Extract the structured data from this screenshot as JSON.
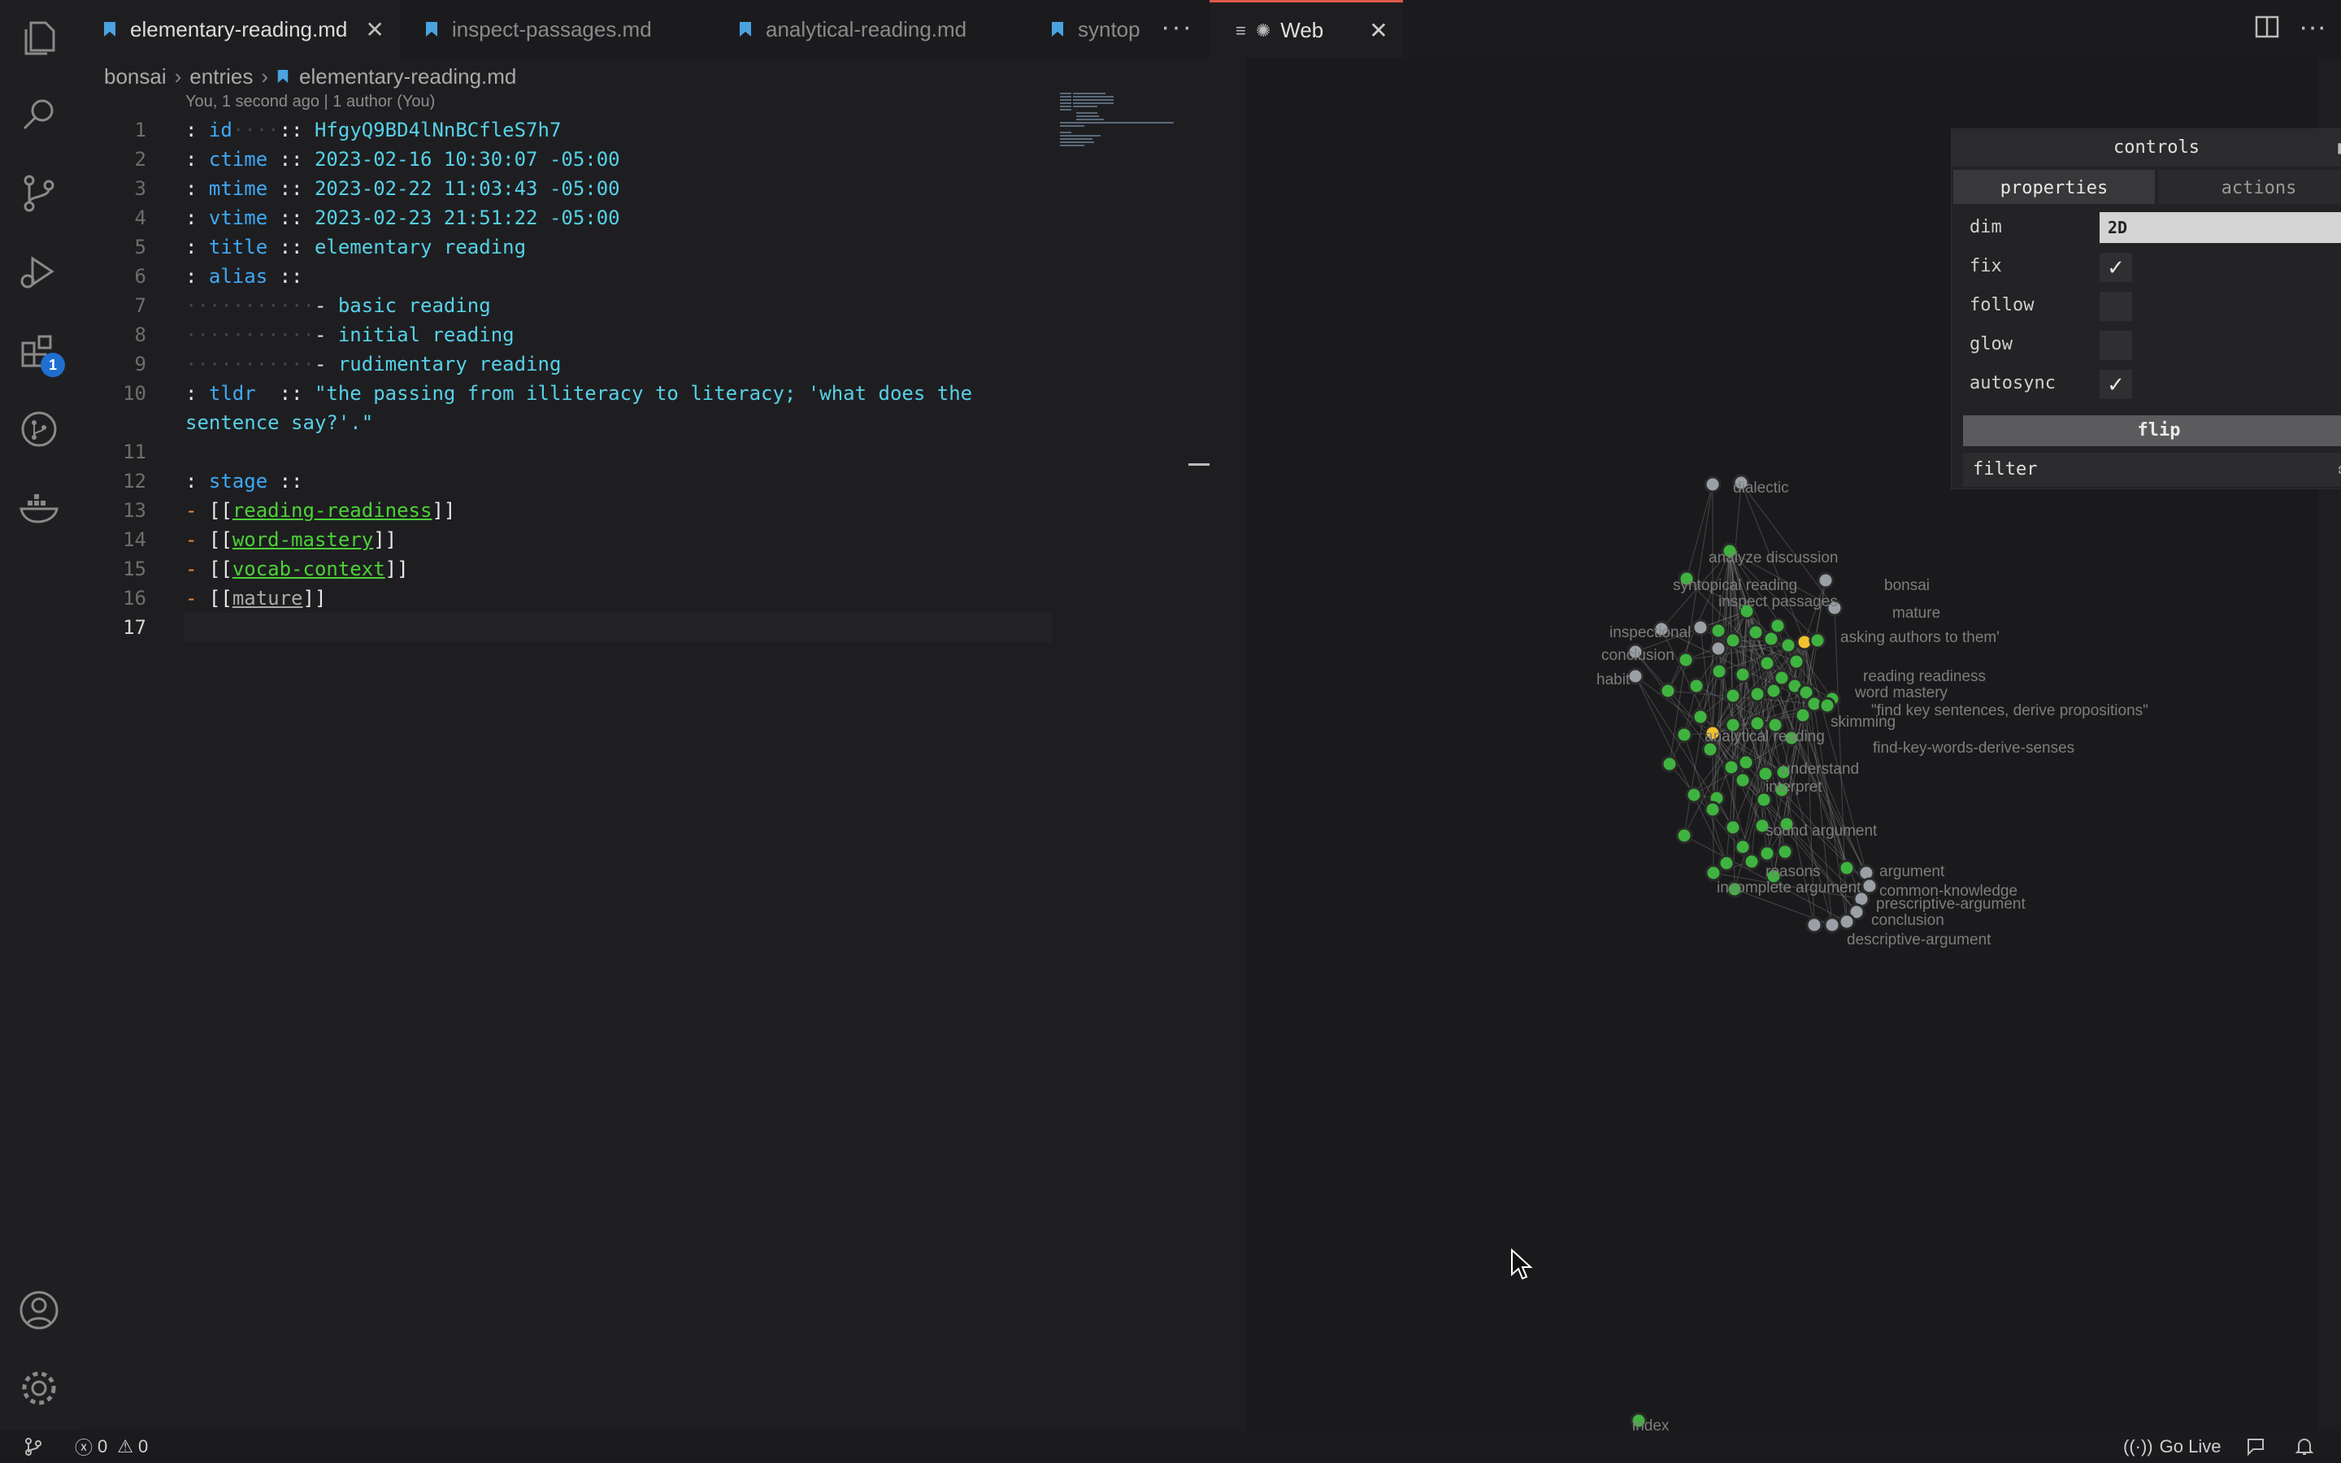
{
  "editor": {
    "tabs": [
      {
        "label": "elementary-reading.md",
        "active": true
      },
      {
        "label": "inspect-passages.md",
        "active": false
      },
      {
        "label": "analytical-reading.md",
        "active": false
      },
      {
        "label": "syntop",
        "active": false
      }
    ],
    "breadcrumb": [
      "bonsai",
      "entries",
      "elementary-reading.md"
    ],
    "blame": "You, 1 second ago | 1 author (You)",
    "line_numbers": [
      "1",
      "2",
      "3",
      "4",
      "5",
      "6",
      "7",
      "8",
      "9",
      "10",
      "",
      "11",
      "12",
      "13",
      "14",
      "15",
      "16",
      "17"
    ],
    "lines": {
      "l1": {
        "key": "id",
        "value": "HfgyQ9BD4lNnBCfleS7h7"
      },
      "l2": {
        "key": "ctime",
        "value": "2023-02-16 10:30:07 -05:00"
      },
      "l3": {
        "key": "mtime",
        "value": "2023-02-22 11:03:43 -05:00"
      },
      "l4": {
        "key": "vtime",
        "value": "2023-02-23 21:51:22 -05:00"
      },
      "l5": {
        "key": "title",
        "value": "elementary reading"
      },
      "l6": {
        "key": "alias"
      },
      "l7": {
        "value": "basic reading"
      },
      "l8": {
        "value": "initial reading"
      },
      "l9": {
        "value": "rudimentary reading"
      },
      "l10": {
        "key": "tldr",
        "value": "\"the passing from illiteracy to literacy; 'what does the",
        "wrap": "sentence say?'.\""
      },
      "l12": {
        "key": "stage"
      },
      "l13": {
        "link": "reading-readiness"
      },
      "l14": {
        "link": "word-mastery"
      },
      "l15": {
        "link": "vocab-context"
      },
      "l16": {
        "link": "mature"
      }
    }
  },
  "web": {
    "tab_label": "Web",
    "controls": {
      "title": "controls",
      "tabs": [
        "properties",
        "actions"
      ],
      "dim_label": "dim",
      "dim_value": "2D",
      "fix_label": "fix",
      "fix_checked": true,
      "follow_label": "follow",
      "follow_checked": false,
      "glow_label": "glow",
      "glow_checked": false,
      "autosync_label": "autosync",
      "autosync_checked": true,
      "flip_label": "flip",
      "filter_label": "filter"
    },
    "graph_labels": {
      "dialectic": "dialectic",
      "analyze_discussion": "analyze discussion",
      "bonsai": "bonsai",
      "mature": "mature",
      "syntopical_reading": "syntopical reading",
      "inspect_passages": "inspect passages",
      "inspectional": "inspectional",
      "conclusion": "conclusion",
      "habit": "habit",
      "analytical_reading": "analytical reading",
      "skimming": "skimming",
      "key_sentences": "\"find key sentences, derive propositions\"",
      "key_words": "find-key-words-derive-senses",
      "understand": "understand",
      "incomplete_argument": "incomplete argument",
      "argument": "argument",
      "common_knowledge": "common-knowledge",
      "prescriptive_argument": "prescriptive-argument",
      "conclusion2": "conclusion",
      "descriptive_argument": "descriptive-argument",
      "index": "index",
      "marking": "marking",
      "question_authors": "asking authors to them'",
      "reading_readiness": "reading readiness",
      "word_mastery": "word mastery",
      "sound_argument": "sound argument",
      "reasons": "reasons",
      "interpret": "interpret"
    },
    "node_colors": {
      "primary": "#3fb33f",
      "neighbor": "#9aa0a6",
      "focus": "#f2c12e"
    }
  },
  "statusbar": {
    "errors": "0",
    "warnings": "0",
    "golive": "Go Live"
  }
}
